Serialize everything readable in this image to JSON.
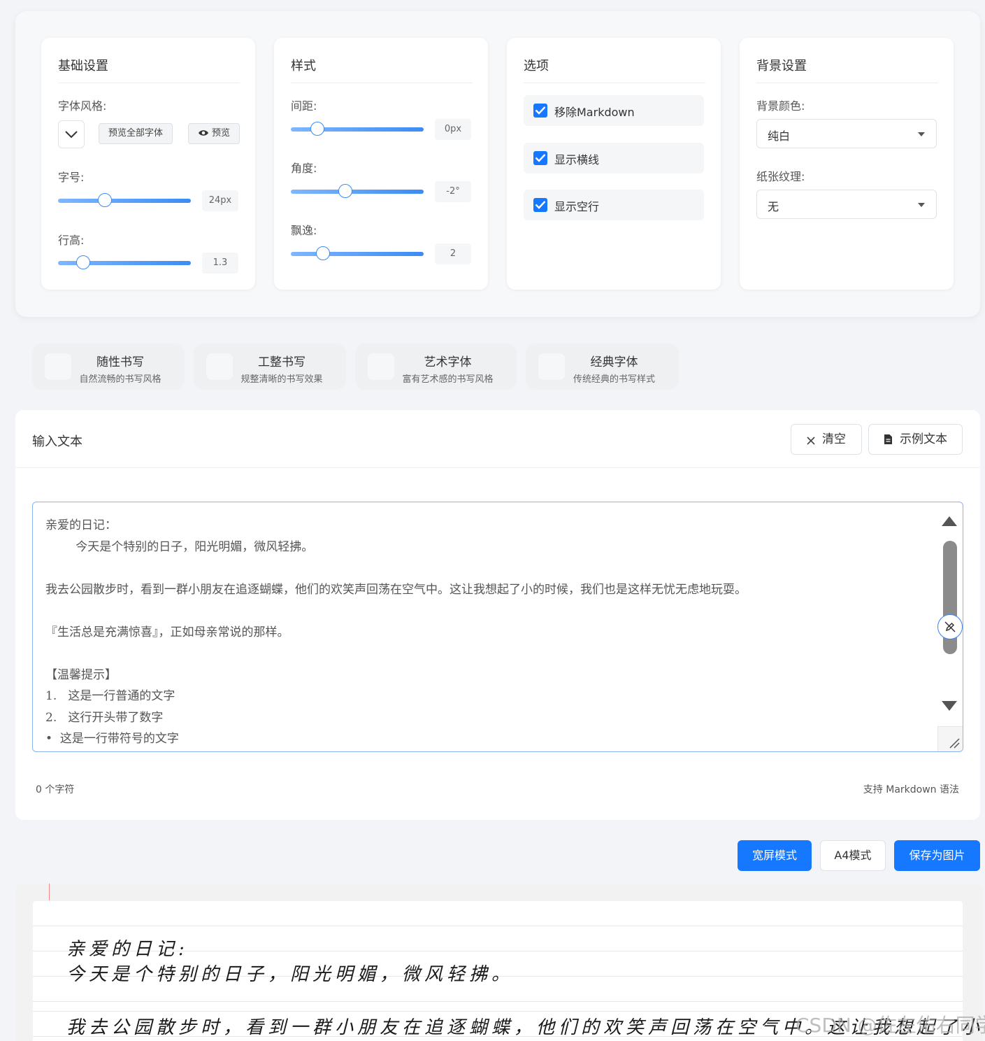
{
  "settings": {
    "basic": {
      "title": "基础设置",
      "font_style_label": "字体风格:",
      "preview_all_btn": "预览全部字体",
      "preview_btn": "预览",
      "font_size_label": "字号:",
      "font_size_value": "24px",
      "line_height_label": "行高:",
      "line_height_value": "1.3"
    },
    "style": {
      "title": "样式",
      "spacing_label": "间距:",
      "spacing_value": "0px",
      "angle_label": "角度:",
      "angle_value": "-2°",
      "float_label": "飘逸:",
      "float_value": "2"
    },
    "options": {
      "title": "选项",
      "items": [
        {
          "label": "移除Markdown",
          "checked": true
        },
        {
          "label": "显示横线",
          "checked": true
        },
        {
          "label": "显示空行",
          "checked": true
        }
      ]
    },
    "background": {
      "title": "背景设置",
      "color_label": "背景颜色:",
      "color_value": "纯白",
      "texture_label": "纸张纹理:",
      "texture_value": "无"
    }
  },
  "slider_levels": {
    "font_size": 0.35,
    "line_height": 0.19,
    "spacing": 0.2,
    "angle": 0.41,
    "float": 0.24
  },
  "style_cards": [
    {
      "title": "随性书写",
      "subtitle": "自然流畅的书写风格"
    },
    {
      "title": "工整书写",
      "subtitle": "规整清晰的书写效果"
    },
    {
      "title": "艺术字体",
      "subtitle": "富有艺术感的书写风格"
    },
    {
      "title": "经典字体",
      "subtitle": "传统经典的书写样式"
    }
  ],
  "input": {
    "title": "输入文本",
    "clear_btn": "清空",
    "example_btn": "示例文本",
    "lines": [
      "亲爱的日记：",
      "        今天是个特别的日子，阳光明媚，微风轻拂。",
      "",
      "我去公园散步时，看到一群小朋友在追逐蝴蝶，他们的欢笑声回荡在空气中。这让我想起了小的时候，我们也是这样无忧无虑地玩耍。",
      "",
      "『生活总是充满惊喜』，正如母亲常说的那样。",
      "",
      "【温馨提示】",
      "1.   这是一行普通的文字",
      "2.   这行开头带了数字",
      "•  这是一行带符号的文字"
    ],
    "char_count": "0 个字符",
    "markdown_hint": "支持 Markdown 语法"
  },
  "actions": {
    "widescreen": "宽屏模式",
    "a4": "A4模式",
    "save": "保存为图片"
  },
  "preview": {
    "lines": [
      "亲爱的日记:",
      "今天是个特别的日子，阳光明媚，微风轻拂。",
      "我去公园散步时，看到一群小朋友在追逐蝴蝶，他们的欢笑声回荡在空气中。这让我想起了小的时"
    ]
  },
  "watermark": "CSDN @佐左佑右同学",
  "colors": {
    "primary": "#1677ff",
    "slider": "#3b8cf5",
    "background": "#f3f4f7"
  }
}
